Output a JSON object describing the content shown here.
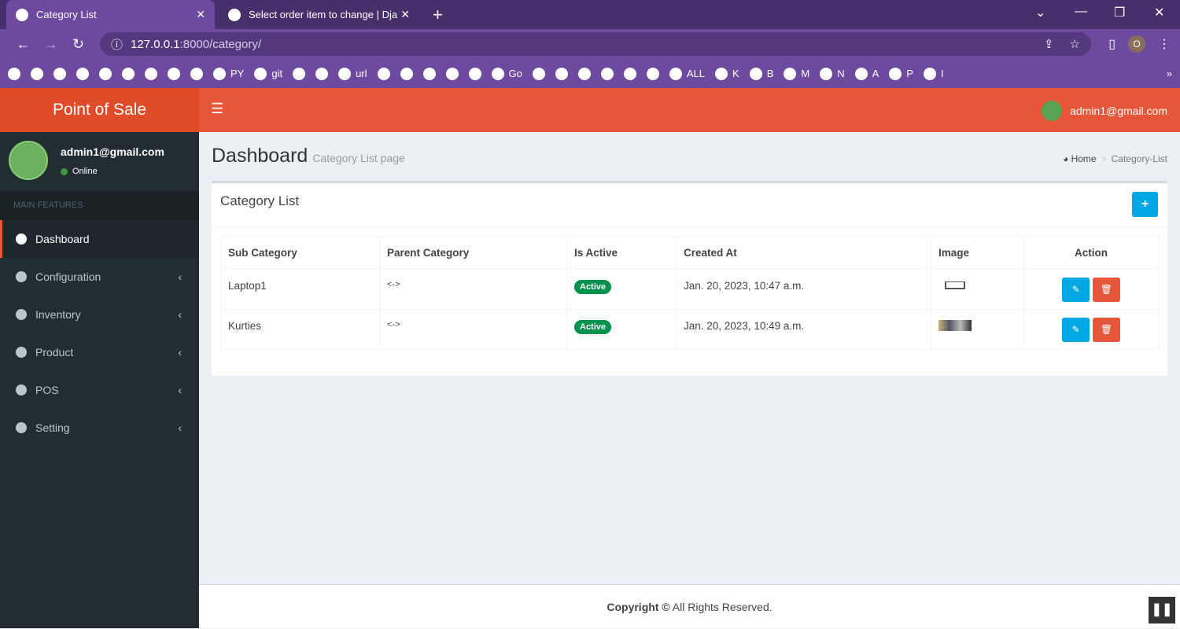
{
  "browser": {
    "tabs": [
      {
        "title": "Category List"
      },
      {
        "title": "Select order item to change | Dja"
      }
    ],
    "new_tab": "+",
    "url_host": "127.0.0.1",
    "url_path": ":8000/category/",
    "profile": "O",
    "bookmarks": [
      {
        "icon": "green-icon",
        "label": ""
      },
      {
        "icon": "plus-icon",
        "label": ""
      },
      {
        "icon": "orange-icon",
        "label": ""
      },
      {
        "icon": "analytics-icon",
        "label": ""
      },
      {
        "icon": "ieee-icon",
        "label": ""
      },
      {
        "icon": "whatsapp-icon",
        "label": ""
      },
      {
        "icon": "telegram-icon",
        "label": ""
      },
      {
        "icon": "google-icon",
        "label": ""
      },
      {
        "icon": "google-icon",
        "label": ""
      },
      {
        "icon": "github-icon",
        "label": "PY"
      },
      {
        "icon": "google-icon",
        "label": "git"
      },
      {
        "icon": "doc-icon",
        "label": ""
      },
      {
        "icon": "store-icon",
        "label": ""
      },
      {
        "icon": "wifi-icon",
        "label": "url"
      },
      {
        "icon": "youtube-icon",
        "label": ""
      },
      {
        "icon": "p-icon",
        "label": ""
      },
      {
        "icon": "camera-icon",
        "label": ""
      },
      {
        "icon": "cart-icon",
        "label": ""
      },
      {
        "icon": "circle-icon",
        "label": ""
      },
      {
        "icon": "go-icon",
        "label": "Go"
      },
      {
        "icon": "bird-icon",
        "label": ""
      },
      {
        "icon": "cl-icon",
        "label": ""
      },
      {
        "icon": "yandex-icon",
        "label": ""
      },
      {
        "icon": "google-icon",
        "label": ""
      },
      {
        "icon": "matlab-icon",
        "label": ""
      },
      {
        "icon": "eye-icon",
        "label": ""
      },
      {
        "icon": "globe-icon",
        "label": "ALL"
      },
      {
        "icon": "google-icon",
        "label": "K"
      },
      {
        "icon": "google-icon",
        "label": "B"
      },
      {
        "icon": "google-icon",
        "label": "M"
      },
      {
        "icon": "google-icon",
        "label": "N"
      },
      {
        "icon": "google-icon",
        "label": "A"
      },
      {
        "icon": "google-icon",
        "label": "P"
      },
      {
        "icon": "google-icon",
        "label": "I"
      }
    ],
    "more": "»"
  },
  "app": {
    "logo": "Point of Sale",
    "header_user": "admin1@gmail.com"
  },
  "sidebar": {
    "user": "admin1@gmail.com",
    "status": "Online",
    "section": "MAIN FEATURES",
    "items": [
      {
        "label": "Dashboard"
      },
      {
        "label": "Configuration"
      },
      {
        "label": "Inventory"
      },
      {
        "label": "Product"
      },
      {
        "label": "POS"
      },
      {
        "label": "Setting"
      }
    ],
    "chev": "‹"
  },
  "page": {
    "title": "Dashboard",
    "subtitle": "Category List page",
    "breadcrumb": {
      "home": "Home",
      "sep": ">",
      "current": "Category-List"
    }
  },
  "box": {
    "title": "Category List",
    "add": "+",
    "headers": [
      "Sub Category",
      "Parent Category",
      "Is Active",
      "Created At",
      "Image",
      "Action"
    ],
    "rows": [
      {
        "sub": "Laptop1",
        "parent": "<->",
        "active": "Active",
        "created": "Jan. 20, 2023, 10:47 a.m."
      },
      {
        "sub": "Kurties",
        "parent": "<->",
        "active": "Active",
        "created": "Jan. 20, 2023, 10:49 a.m."
      }
    ]
  },
  "footer": {
    "bold": "Copyright ©",
    "rest": " All Rights Reserved."
  },
  "colors": {
    "header": "#e8563a",
    "sidebar": "#222d32",
    "primary": "#00a7e5",
    "success": "#00914c",
    "browser": "#6d4aa0"
  }
}
